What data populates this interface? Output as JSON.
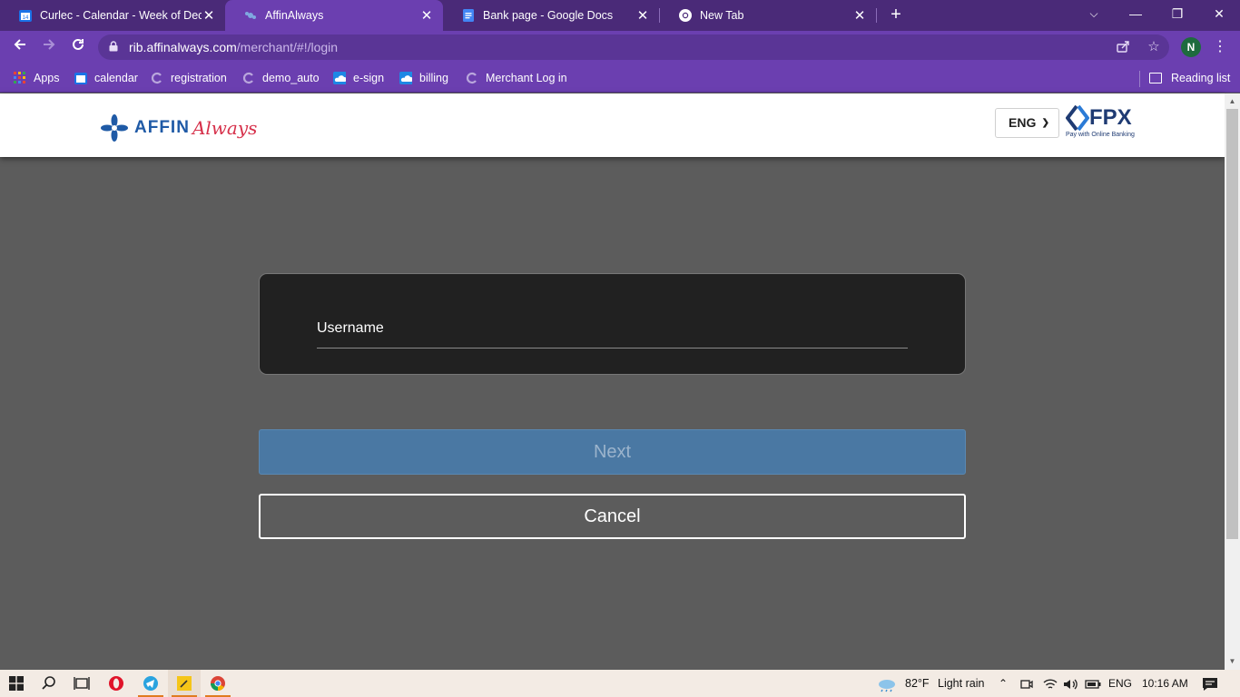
{
  "browser": {
    "tabs": [
      {
        "title": "Curlec - Calendar - Week of Dece",
        "icon": "calendar-icon",
        "active": false
      },
      {
        "title": "AffinAlways",
        "icon": "affin-icon",
        "active": true
      },
      {
        "title": "Bank page - Google Docs",
        "icon": "docs-icon",
        "active": false
      },
      {
        "title": "New Tab",
        "icon": "chrome-icon",
        "active": false
      }
    ],
    "close_glyph": "✕",
    "new_tab_glyph": "+",
    "window_controls": {
      "tab_search": "⌵",
      "minimize": "—",
      "restore": "❐",
      "close": "✕"
    },
    "url_host": "rib.affinalways.com",
    "url_path": "/merchant/#!/login",
    "profile_initial": "N",
    "bookmarks": [
      {
        "label": "Apps",
        "icon": "apps-grid-icon"
      },
      {
        "label": "calendar",
        "icon": "calendar-icon"
      },
      {
        "label": "registration",
        "icon": "curlec-icon"
      },
      {
        "label": "demo_auto",
        "icon": "curlec-icon"
      },
      {
        "label": "e-sign",
        "icon": "cloud-icon"
      },
      {
        "label": "billing",
        "icon": "cloud-icon"
      },
      {
        "label": "Merchant Log in",
        "icon": "curlec-icon"
      }
    ],
    "reading_list": "Reading list"
  },
  "site": {
    "logo_affin": "AFFIN",
    "logo_always": "Always",
    "language": "ENG",
    "fpx_title": "FPX",
    "fpx_tagline": "Pay with Online Banking"
  },
  "login": {
    "username_label": "Username",
    "username_value": "",
    "next_label": "Next",
    "cancel_label": "Cancel"
  },
  "taskbar": {
    "weather_temp": "82°F",
    "weather_text": "Light rain",
    "language": "ENG",
    "time": "10:16 AM"
  },
  "colors": {
    "tabstrip": "#4a2a78",
    "toolbar": "#6b3fb0",
    "page_bg": "#5c5c5c",
    "card_bg": "#212121",
    "next_button": "#4a78a3",
    "affin_blue": "#1f5aa6",
    "always_red": "#d6304a",
    "fpx_navy": "#1f3b73"
  }
}
